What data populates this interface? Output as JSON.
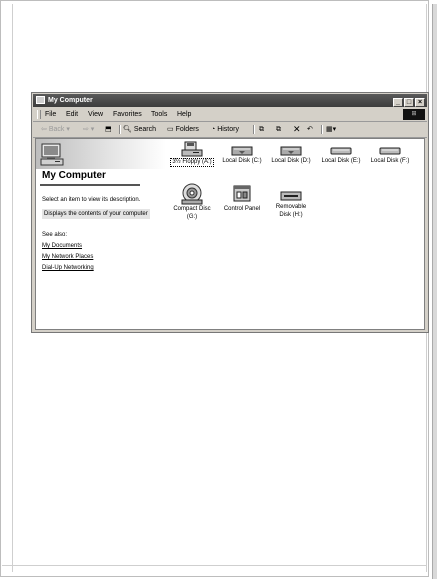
{
  "window": {
    "title": "My Computer",
    "controls": {
      "minimize": "_",
      "maximize": "□",
      "close": "×"
    }
  },
  "menu": {
    "items": [
      {
        "label": "File"
      },
      {
        "label": "Edit"
      },
      {
        "label": "View"
      },
      {
        "label": "Favorites"
      },
      {
        "label": "Tools"
      },
      {
        "label": "Help"
      }
    ]
  },
  "toolbar": {
    "back": "Back",
    "search": "Search",
    "folders": "Folders",
    "history": "History"
  },
  "left_pane": {
    "title": "My Computer",
    "hint": "Select an item to view its description.",
    "description": "Displays the contents of your computer",
    "see_also_label": "See also:",
    "links": [
      "My Documents",
      "My Network Places",
      "Dial-Up Networking"
    ]
  },
  "drives": [
    {
      "label": "3½ Floppy (A:)",
      "icon": "floppy-drive-icon",
      "selected": true
    },
    {
      "label": "Local Disk (C:)",
      "icon": "hard-disk-icon"
    },
    {
      "label": "Local Disk (D:)",
      "icon": "hard-disk-icon"
    },
    {
      "label": "Local Disk (E:)",
      "icon": "hard-disk-icon"
    },
    {
      "label": "Local Disk (F:)",
      "icon": "hard-disk-icon"
    },
    {
      "label_line1": "Compact Disc",
      "label_line2": "(G:)",
      "icon": "cd-drive-icon"
    },
    {
      "label": "Control Panel",
      "icon": "control-panel-icon"
    },
    {
      "label_line1": "Removable",
      "label_line2": "Disk (H:)",
      "icon": "removable-disk-icon"
    }
  ]
}
